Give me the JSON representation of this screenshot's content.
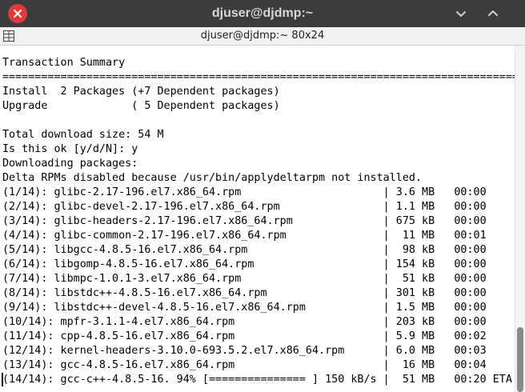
{
  "window": {
    "title": "djuser@djdmp:~"
  },
  "terminal": {
    "title": "djuser@djdmp:~ 80x24",
    "lines": [
      "Transaction Summary",
      "================================================================================",
      "Install  2 Packages (+7 Dependent packages)",
      "Upgrade             ( 5 Dependent packages)",
      "",
      "Total download size: 54 M",
      "Is this ok [y/d/N]: y",
      "Downloading packages:",
      "Delta RPMs disabled because /usr/bin/applydeltarpm not installed.",
      "(1/14): glibc-2.17-196.el7.x86_64.rpm                      | 3.6 MB   00:00",
      "(2/14): glibc-devel-2.17-196.el7.x86_64.rpm                | 1.1 MB   00:00",
      "(3/14): glibc-headers-2.17-196.el7.x86_64.rpm              | 675 kB   00:00",
      "(4/14): glibc-common-2.17-196.el7.x86_64.rpm               |  11 MB   00:01",
      "(5/14): libgcc-4.8.5-16.el7.x86_64.rpm                     |  98 kB   00:00",
      "(6/14): libgomp-4.8.5-16.el7.x86_64.rpm                    | 154 kB   00:00",
      "(7/14): libmpc-1.0.1-3.el7.x86_64.rpm                      |  51 kB   00:00",
      "(8/14): libstdc++-4.8.5-16.el7.x86_64.rpm                  | 301 kB   00:00",
      "(9/14): libstdc++-devel-4.8.5-16.el7.x86_64.rpm            | 1.5 MB   00:00",
      "(10/14): mpfr-3.1.1-4.el7.x86_64.rpm                       | 203 kB   00:00",
      "(11/14): cpp-4.8.5-16.el7.x86_64.rpm                       | 5.9 MB   00:02",
      "(12/14): kernel-headers-3.10.0-693.5.2.el7.x86_64.rpm      | 6.0 MB   00:03",
      "(13/14): gcc-4.8.5-16.el7.x86_64.rpm                       |  16 MB   00:04",
      "(14/14): gcc-c++-4.8.5-16. 94% [=============== ] 150 kB/s |  51 MB   00:20 ETA"
    ]
  },
  "icons": {
    "close": "close-icon",
    "minimize": "minimize-icon",
    "maximize": "maximize-icon",
    "menu": "terminal-menu-icon"
  },
  "colors": {
    "titlebar": "#3c3c3c",
    "close_button": "#e2393a",
    "terminal_bg": "#ffffff",
    "terminal_fg": "#000000"
  }
}
